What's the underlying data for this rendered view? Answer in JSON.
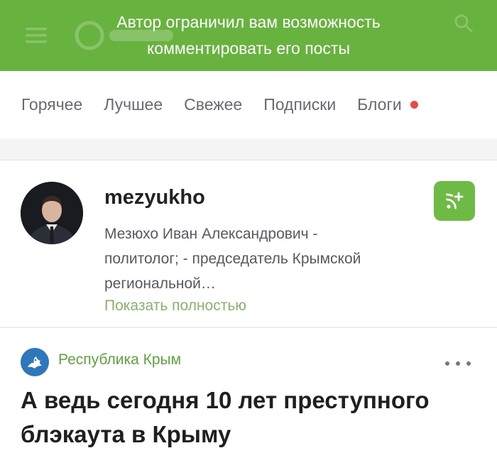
{
  "toast": {
    "line1": "Автор ограничил вам возможность",
    "line2": "комментировать его посты"
  },
  "nav": {
    "tabs": [
      {
        "label": "Горячее"
      },
      {
        "label": "Лучшее"
      },
      {
        "label": "Свежее"
      },
      {
        "label": "Подписки"
      },
      {
        "label": "Блоги"
      }
    ]
  },
  "profile": {
    "username": "mezyukho",
    "bio": "Мезюхо Иван Александрович - политолог; - председатель Крымской региональной…",
    "show_more": "Показать полностью"
  },
  "post": {
    "community": "Республика Крым",
    "title": "А ведь сегодня 10 лет преступного блэкаута в Крыму"
  },
  "colors": {
    "accent_green": "#68b33f",
    "link_green": "#84b56a",
    "notification_dot": "#e94b44",
    "community_blue": "#2e77bd"
  },
  "icons": [
    "menu-icon",
    "logo-icon",
    "search-icon",
    "subscribe-rss-icon",
    "more-dots-icon",
    "community-logo-icon"
  ]
}
